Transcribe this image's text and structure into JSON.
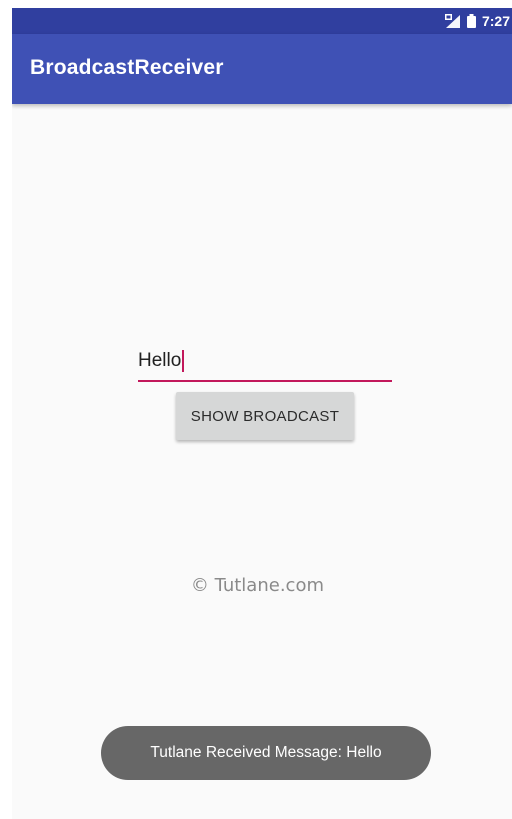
{
  "status_bar": {
    "time": "7:27",
    "icons": [
      "sim-card-icon",
      "battery-icon"
    ],
    "background": "#303f9f"
  },
  "app_bar": {
    "title": "BroadcastReceiver",
    "background": "#3f51b5"
  },
  "form": {
    "input_value": "Hello",
    "input_accent": "#c2185b",
    "button_label": "SHOW BROADCAST"
  },
  "watermark": "© Tutlane.com",
  "toast": {
    "message": "Tutlane Received Message: Hello"
  }
}
